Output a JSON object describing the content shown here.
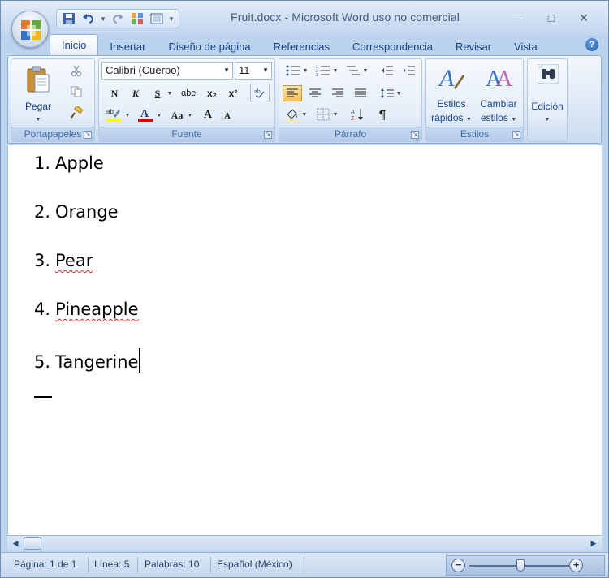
{
  "window": {
    "title": "Fruit.docx - Microsoft Word uso no comercial",
    "controls": {
      "minimize": "—",
      "maximize": "□",
      "close": "✕"
    }
  },
  "quick_access": {
    "icons": [
      "save-icon",
      "undo-icon",
      "redo-icon",
      "layout-icon",
      "print-preview-icon",
      "customize-icon"
    ]
  },
  "tabs": [
    {
      "label": "Inicio",
      "active": true
    },
    {
      "label": "Insertar"
    },
    {
      "label": "Diseño de página"
    },
    {
      "label": "Referencias"
    },
    {
      "label": "Correspondencia"
    },
    {
      "label": "Revisar"
    },
    {
      "label": "Vista"
    }
  ],
  "ribbon": {
    "clipboard": {
      "group_label": "Portapapeles",
      "paste_label": "Pegar"
    },
    "font": {
      "group_label": "Fuente",
      "font_name": "Calibri (Cuerpo)",
      "font_size": "11",
      "bold": "N",
      "italic": "K",
      "underline": "S",
      "strikethrough": "abc",
      "subscript": "x₂",
      "superscript": "x²",
      "change_case": "Aa",
      "grow": "A",
      "shrink": "A",
      "highlight_color": "#ffff00",
      "font_color": "#e00000"
    },
    "paragraph": {
      "group_label": "Párrafo"
    },
    "styles": {
      "group_label": "Estilos",
      "quick_styles_line1": "Estilos",
      "quick_styles_line2": "rápidos",
      "change_styles_line1": "Cambiar",
      "change_styles_line2": "estilos"
    },
    "editing": {
      "label": "Edición"
    }
  },
  "document": {
    "lines": [
      {
        "number": "1.",
        "text": "Apple",
        "misspelled": false
      },
      {
        "number": "2.",
        "text": "Orange",
        "misspelled": false
      },
      {
        "number": "3.",
        "text": "Pear",
        "misspelled": true
      },
      {
        "number": "4.",
        "text": "Pineapple",
        "misspelled": true
      },
      {
        "number": "5.",
        "text": "Tangerine",
        "misspelled": false
      }
    ]
  },
  "statusbar": {
    "page": "Página: 1 de 1",
    "line": "Línea: 5",
    "words": "Palabras: 10",
    "language": "Español (México)"
  },
  "colors": {
    "accent": "#15428b",
    "ribbon_bg": "#dfe9f6",
    "spell_error": "#e02020"
  }
}
